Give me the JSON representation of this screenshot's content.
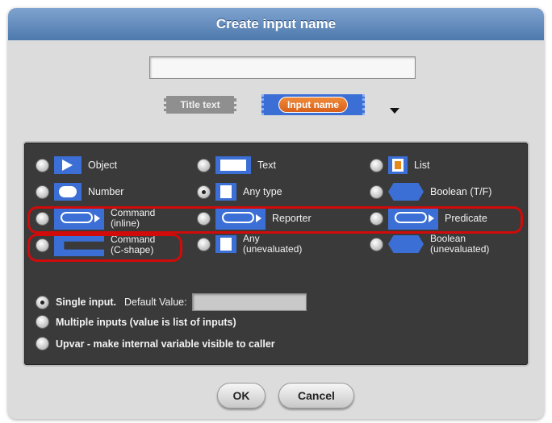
{
  "dialog": {
    "title": "Create input name",
    "name_value": "",
    "title_text_label": "Title text",
    "input_name_label": "Input name"
  },
  "types": {
    "object": "Object",
    "text": "Text",
    "list": "List",
    "number": "Number",
    "any_type": "Any type",
    "boolean": "Boolean (T/F)",
    "command_inline": "Command\n(inline)",
    "reporter": "Reporter",
    "predicate": "Predicate",
    "command_cshape": "Command\n(C-shape)",
    "any_unevaluated": "Any\n(unevaluated)",
    "boolean_unevaluated": "Boolean\n(unevaluated)",
    "selected": "any_type"
  },
  "modes": {
    "single": "Single input.",
    "default_value_label": "Default Value:",
    "default_value": "",
    "multiple": "Multiple inputs (value is list of inputs)",
    "upvar": "Upvar - make internal variable visible to caller",
    "selected": "single"
  },
  "buttons": {
    "ok": "OK",
    "cancel": "Cancel"
  },
  "colors": {
    "title_bar": "#5b86bb",
    "panel": "#3a3a3a",
    "block_blue": "#3b6fd6",
    "highlight_red": "#d10a0a",
    "input_name_orange": "#e4722a"
  }
}
